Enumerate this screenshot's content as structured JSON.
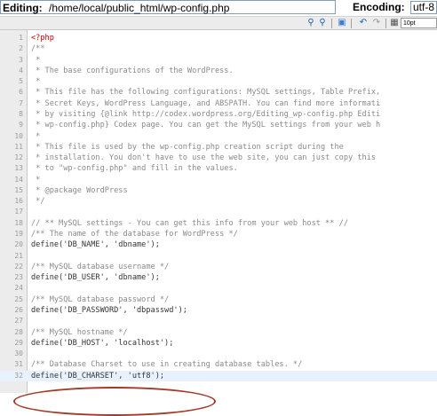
{
  "header": {
    "editing_label": "Editing:",
    "file_path": "/home/local/public_html/wp-config.php",
    "encoding_label": "Encoding:",
    "encoding_value": "utf-8"
  },
  "toolbar": {
    "font_size": "10pt"
  },
  "editor": {
    "line_numbers": [
      "1",
      "2",
      "3",
      "4",
      "5",
      "6",
      "7",
      "8",
      "9",
      "10",
      "11",
      "12",
      "13",
      "14",
      "15",
      "16",
      "17",
      "18",
      "19",
      "20",
      "21",
      "22",
      "23",
      "24",
      "25",
      "26",
      "27",
      "28",
      "29",
      "30",
      "31",
      "32"
    ],
    "lines": [
      "<?php",
      "/**",
      " *",
      " * The base configurations of the WordPress.",
      " *",
      " * This file has the following configurations: MySQL settings, Table Prefix,",
      " * Secret Keys, WordPress Language, and ABSPATH. You can find more informati",
      " * by visiting {@link http://codex.wordpress.org/Editing_wp-config.php Editi",
      " * wp-config.php} Codex page. You can get the MySQL settings from your web h",
      " *",
      " * This file is used by the wp-config.php creation script during the",
      " * installation. You don't have to use the web site, you can just copy this",
      " * to \"wp-config.php\" and fill in the values.",
      " *",
      " * @package WordPress",
      " */",
      "",
      "// ** MySQL settings - You can get this info from your web host ** //",
      "/** The name of the database for WordPress */",
      "define('DB_NAME', 'dbname');",
      "",
      "/** MySQL database username */",
      "define('DB_USER', 'dbname');",
      "",
      "/** MySQL database password */",
      "define('DB_PASSWORD', 'dbpasswd');",
      "",
      "/** MySQL hostname */",
      "define('DB_HOST', 'localhost');",
      "",
      "/** Database Charset to use in creating database tables. */",
      "define('DB_CHARSET', 'utf8');",
      ""
    ],
    "highlight_color": "#a23b2a"
  }
}
